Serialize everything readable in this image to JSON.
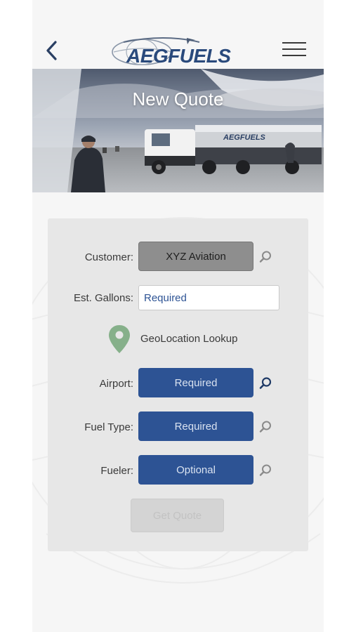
{
  "header": {
    "logo_text": "AEGFUELS",
    "back_icon": "chevron-left-icon",
    "menu_icon": "hamburger-menu-icon"
  },
  "hero": {
    "title": "New Quote",
    "truck_logo_text": "AEGFUELS"
  },
  "form": {
    "customer": {
      "label": "Customer:",
      "value": "XYZ Aviation",
      "search_icon": "search-icon"
    },
    "gallons": {
      "label": "Est. Gallons:",
      "placeholder": "Required"
    },
    "geolocation": {
      "label": "GeoLocation Lookup",
      "icon": "map-pin-icon"
    },
    "airport": {
      "label": "Airport:",
      "value": "Required",
      "search_icon": "search-icon"
    },
    "fuel_type": {
      "label": "Fuel Type:",
      "value": "Required",
      "search_icon": "search-icon"
    },
    "fueler": {
      "label": "Fueler:",
      "value": "Optional",
      "search_icon": "search-icon"
    },
    "submit": {
      "label": "Get Quote"
    }
  },
  "colors": {
    "brand_blue": "#2d5394",
    "field_grey": "#8e8e8e",
    "pin_green": "#86b08a",
    "card_bg": "#e7e7e7"
  }
}
